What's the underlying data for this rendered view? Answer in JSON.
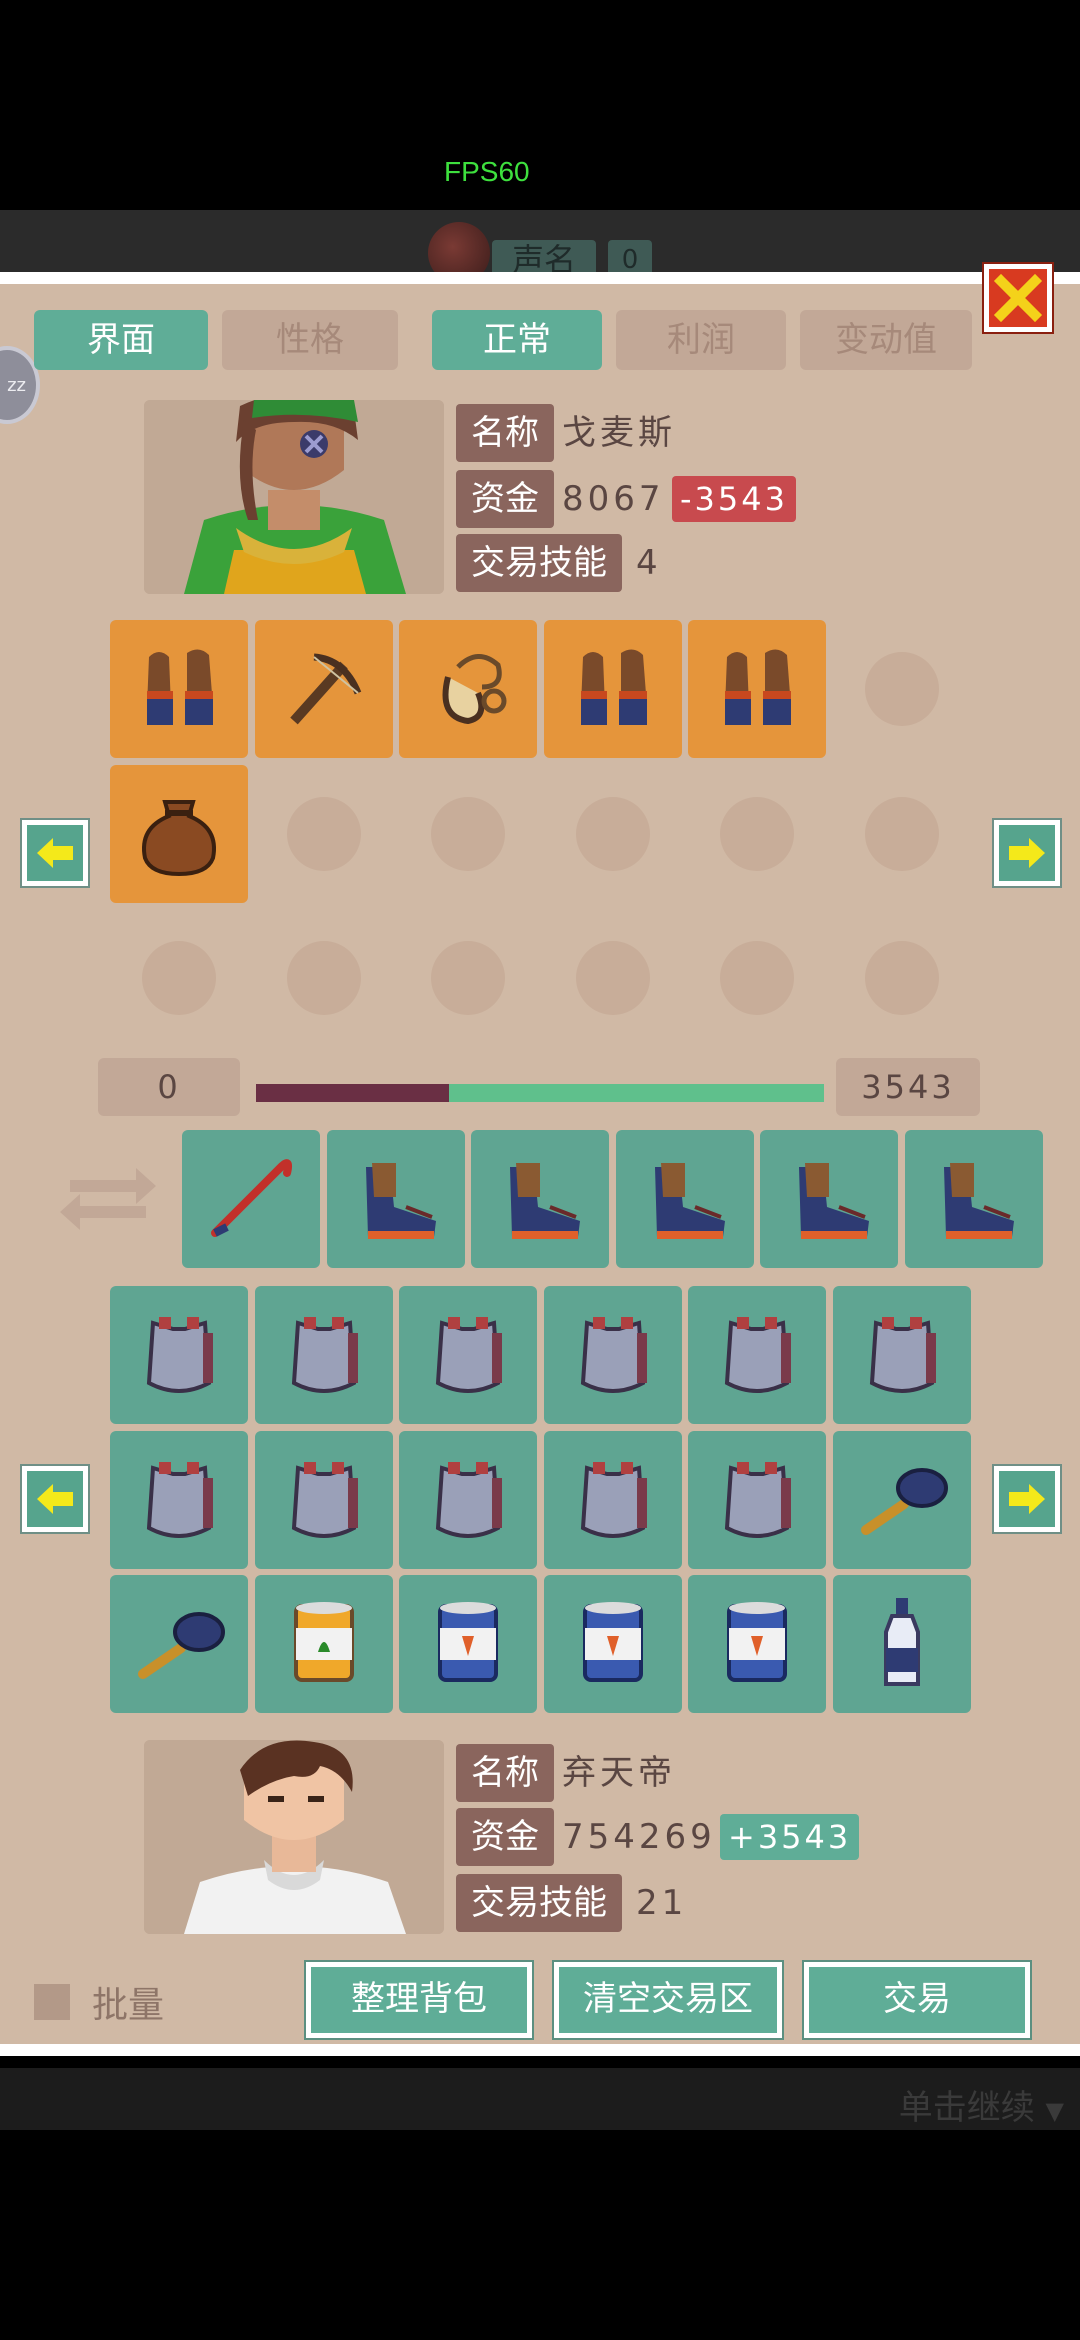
{
  "status": {
    "fps": "FPS60"
  },
  "top": {
    "name_label": "声名",
    "count": "0"
  },
  "side_disk": {
    "text": "zz"
  },
  "tabs_left": [
    {
      "label": "界面",
      "active": true
    },
    {
      "label": "性格",
      "active": false
    }
  ],
  "tabs_right": [
    {
      "label": "正常",
      "active": true
    },
    {
      "label": "利润",
      "active": false
    },
    {
      "label": "变动值",
      "active": false
    }
  ],
  "merchant": {
    "name_label": "名称",
    "name": "戈麦斯",
    "funds_label": "资金",
    "funds": "8067",
    "funds_delta": "-3543",
    "skill_label": "交易技能",
    "skill": "4"
  },
  "merchant_inventory": [
    {
      "icon": "gloves"
    },
    {
      "icon": "crossbow"
    },
    {
      "icon": "rope-sling"
    },
    {
      "icon": "gloves"
    },
    {
      "icon": "gloves"
    },
    {
      "icon": "empty"
    },
    {
      "icon": "pouch"
    },
    {
      "icon": "empty"
    },
    {
      "icon": "empty"
    },
    {
      "icon": "empty"
    },
    {
      "icon": "empty"
    },
    {
      "icon": "empty"
    },
    {
      "icon": "empty"
    },
    {
      "icon": "empty"
    },
    {
      "icon": "empty"
    },
    {
      "icon": "empty"
    },
    {
      "icon": "empty"
    },
    {
      "icon": "empty"
    }
  ],
  "balance": {
    "left": "0",
    "right": "3543",
    "ratio": 0.34
  },
  "trade_area": [
    {
      "icon": "crowbar"
    },
    {
      "icon": "boots"
    },
    {
      "icon": "boots"
    },
    {
      "icon": "boots"
    },
    {
      "icon": "boots"
    },
    {
      "icon": "boots"
    }
  ],
  "player_inventory": [
    {
      "icon": "armor"
    },
    {
      "icon": "armor"
    },
    {
      "icon": "armor"
    },
    {
      "icon": "armor"
    },
    {
      "icon": "armor"
    },
    {
      "icon": "armor"
    },
    {
      "icon": "armor"
    },
    {
      "icon": "armor"
    },
    {
      "icon": "armor"
    },
    {
      "icon": "armor"
    },
    {
      "icon": "armor"
    },
    {
      "icon": "frying-pan"
    },
    {
      "icon": "frying-pan"
    },
    {
      "icon": "can-vegetable"
    },
    {
      "icon": "can-carrot"
    },
    {
      "icon": "can-carrot"
    },
    {
      "icon": "can-carrot"
    },
    {
      "icon": "bottle"
    }
  ],
  "player": {
    "name_label": "名称",
    "name": "弃天帝",
    "funds_label": "资金",
    "funds": "754269",
    "funds_delta": "+3543",
    "skill_label": "交易技能",
    "skill": "21"
  },
  "footer": {
    "batch_label": "批量",
    "sort_label": "整理背包",
    "clear_label": "清空交易区",
    "trade_label": "交易"
  },
  "continue_label": "单击继续",
  "colors": {
    "teal": "#5fad97",
    "orange": "#e5953b",
    "panel": "#d0b9a5",
    "negative": "#c84a4e"
  }
}
